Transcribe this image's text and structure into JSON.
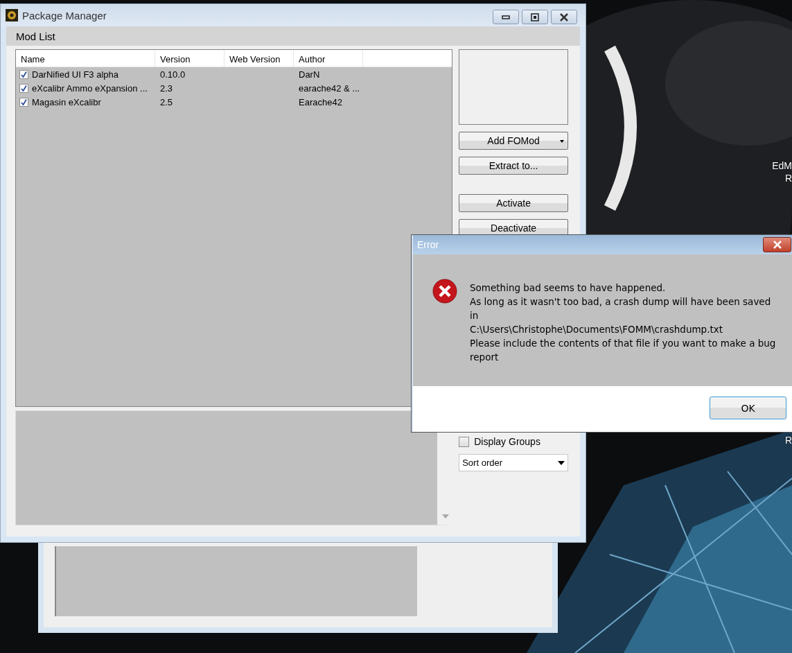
{
  "desktop": {
    "icon_labels": [
      "EdM",
      "R",
      "R"
    ]
  },
  "back_window": {
    "kind": "window"
  },
  "main_window": {
    "title": "Package Manager",
    "section": "Mod List",
    "mod_list": {
      "columns": [
        "Name",
        "Version",
        "Web Version",
        "Author"
      ],
      "rows": [
        {
          "checked": true,
          "name": "DarNified UI F3 alpha",
          "version": "0.10.0",
          "author": "DarN"
        },
        {
          "checked": true,
          "name": "eXcalibr Ammo eXpansion ...",
          "version": "2.3",
          "author": "earache42 & ..."
        },
        {
          "checked": true,
          "name": "Magasin eXcalibr",
          "version": "2.5",
          "author": "Earache42"
        }
      ]
    },
    "buttons": [
      {
        "label": "Add FOMod",
        "kind": "dropdown"
      },
      {
        "label": "Extract to...",
        "kind": "plain"
      },
      {
        "label": "Activate",
        "kind": "plain"
      },
      {
        "label": "Deactivate",
        "kind": "plain"
      }
    ],
    "display_groups": {
      "label": "Display Groups",
      "checked": false
    },
    "sort": {
      "value": "Sort order"
    }
  },
  "error_dialog": {
    "title": "Error",
    "lines": [
      "Something bad seems to have happened.",
      "As long as it wasn't too bad, a crash dump will have been saved in",
      "C:\\Users\\Christophe\\Documents\\FOMM\\crashdump.txt",
      "Please include the contents of that file if you want to make a bug report"
    ],
    "button": "OK"
  }
}
